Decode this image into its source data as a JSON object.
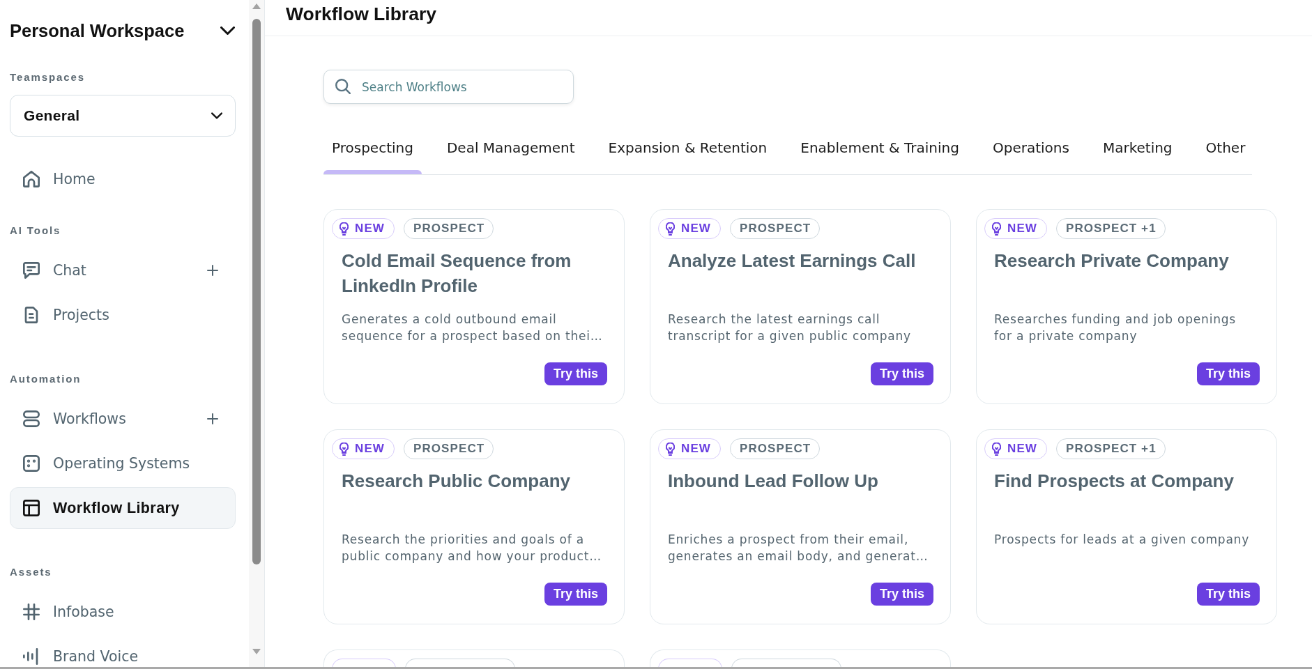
{
  "sidebar": {
    "workspace": {
      "title": "Personal Workspace"
    },
    "teamspaces": {
      "label": "Teamspaces",
      "value": "General"
    },
    "sections": [
      {
        "items": [
          {
            "label": "Home",
            "selected": false,
            "add_button": false
          }
        ]
      },
      {
        "label": "AI Tools",
        "items": [
          {
            "label": "Chat",
            "selected": false,
            "add_button": true
          },
          {
            "label": "Projects",
            "selected": false,
            "add_button": false
          }
        ]
      },
      {
        "label": "Automation",
        "items": [
          {
            "label": "Workflows",
            "selected": false,
            "add_button": true
          },
          {
            "label": "Operating Systems",
            "selected": false,
            "add_button": false
          },
          {
            "label": "Workflow Library",
            "selected": true,
            "add_button": false
          }
        ]
      },
      {
        "label": "Assets",
        "items": [
          {
            "label": "Infobase",
            "selected": false,
            "add_button": false
          },
          {
            "label": "Brand Voice",
            "selected": false,
            "add_button": false
          }
        ]
      }
    ]
  },
  "header": {
    "title": "Workflow Library"
  },
  "search": {
    "placeholder": "Search Workflows"
  },
  "tabs": [
    {
      "label": "Prospecting",
      "selected": true
    },
    {
      "label": "Deal Management",
      "selected": false
    },
    {
      "label": "Expansion & Retention",
      "selected": false
    },
    {
      "label": "Enablement & Training",
      "selected": false
    },
    {
      "label": "Operations",
      "selected": false
    },
    {
      "label": "Marketing",
      "selected": false
    },
    {
      "label": "Other",
      "selected": false
    }
  ],
  "cards": [
    {
      "kind": "full",
      "badges": [
        {
          "kind": "new",
          "label": "NEW"
        },
        {
          "kind": "category",
          "label": "PROSPECT"
        }
      ],
      "title": "Cold Email Sequence from LinkedIn Profile",
      "description_lines": [
        "Generates a cold outbound email",
        "sequence for a prospect based on thei…"
      ],
      "button": "Try this"
    },
    {
      "kind": "full",
      "badges": [
        {
          "kind": "new",
          "label": "NEW"
        },
        {
          "kind": "category",
          "label": "PROSPECT"
        }
      ],
      "title": "Analyze Latest Earnings Call",
      "description_lines": [
        "Research the latest earnings call",
        "transcript for a given public company"
      ],
      "button": "Try this"
    },
    {
      "kind": "full",
      "badges": [
        {
          "kind": "new",
          "label": "NEW"
        },
        {
          "kind": "category",
          "label": "PROSPECT +1"
        }
      ],
      "title": "Research Private Company",
      "description_lines": [
        "Researches funding and job openings",
        "for a private company"
      ],
      "button": "Try this"
    },
    {
      "kind": "full",
      "badges": [
        {
          "kind": "new",
          "label": "NEW"
        },
        {
          "kind": "category",
          "label": "PROSPECT"
        }
      ],
      "title": "Research Public Company",
      "description_lines": [
        "Research the priorities and goals of a",
        "public company and how your product…"
      ],
      "button": "Try this"
    },
    {
      "kind": "full",
      "badges": [
        {
          "kind": "new",
          "label": "NEW"
        },
        {
          "kind": "category",
          "label": "PROSPECT"
        }
      ],
      "title": "Inbound Lead Follow Up",
      "description_lines": [
        "Enriches a prospect from their email,",
        "generates an email body, and generat…"
      ],
      "button": "Try this"
    },
    {
      "kind": "full",
      "badges": [
        {
          "kind": "new",
          "label": "NEW"
        },
        {
          "kind": "category",
          "label": "PROSPECT +1"
        }
      ],
      "title": "Find Prospects at Company",
      "description_lines": [
        "Prospects for leads at a given company"
      ],
      "button": "Try this"
    },
    {
      "kind": "cut",
      "badges": [
        {
          "kind": "new"
        },
        {
          "kind": "category"
        }
      ]
    },
    {
      "kind": "cut",
      "badges": [
        {
          "kind": "new"
        },
        {
          "kind": "category"
        }
      ]
    }
  ]
}
